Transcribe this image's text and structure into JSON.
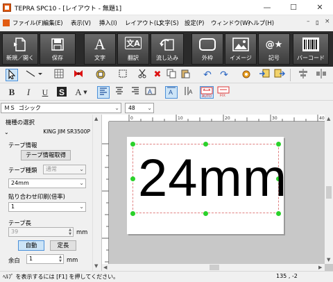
{
  "window": {
    "title": "TEPRA SPC10 - [レイアウト - 無題1]",
    "minimize_glyph": "—",
    "maximize_glyph": "☐",
    "close_glyph": "✕"
  },
  "menu": {
    "items": [
      "ファイル(F)",
      "編集(E)",
      "表示(V)",
      "挿入(I)",
      "レイアウト(L)",
      "文字(S)",
      "設定(P)",
      "ウィンドウ(W)",
      "ヘルプ(H)"
    ],
    "mdi_min": "–",
    "mdi_restore": "ﾛ",
    "mdi_close": "×"
  },
  "ribbon": {
    "buttons": [
      "新規／開く",
      "保存",
      "文字",
      "翻訳",
      "流し込み",
      "外枠",
      "イメージ",
      "記号",
      "バーコード"
    ],
    "glyphs": {
      "text": "A",
      "translate": "文A",
      "symbol": "@★"
    }
  },
  "toolbar1": {
    "icons": [
      "select-arrow-icon",
      "line-icon",
      "table-icon",
      "ribbon-icon",
      "print-icon",
      "frame-select-icon",
      "cut-icon",
      "delete-icon",
      "copy-icon",
      "paste-icon",
      "undo-icon",
      "redo-icon",
      "settings-icon",
      "import-icon",
      "export-icon",
      "align-icon",
      "distribute-icon"
    ]
  },
  "toolbar2": {
    "bold": "B",
    "italic": "I",
    "underline": "U",
    "font_a": "A"
  },
  "font_bar": {
    "font_name": "ＭＳ ゴシック",
    "font_size": "48"
  },
  "left_panel": {
    "model_label": "機種の選択",
    "model_value": "KING JIM SR3500P",
    "tape_info_label": "テープ情報",
    "get_tape_info_button": "テープ情報取得",
    "tape_type_label": "テープ種類",
    "tape_type_value": "通常",
    "tape_width_value": "24mm",
    "paste_print_label": "貼り合わせ印刷(倍率)",
    "paste_print_value": "1",
    "tape_length_label": "テープ長",
    "tape_length_value": "39",
    "tape_length_unit": "mm",
    "auto_button": "自動",
    "fixed_length_button": "定長",
    "margin_label": "余白",
    "margin_value": "1",
    "margin_unit": "mm"
  },
  "canvas": {
    "label_text": "24mm",
    "ruler_labels": [
      "0",
      "10",
      "20",
      "30",
      "40"
    ]
  },
  "status": {
    "help_text": "ﾍﾙﾌﾟ を表示するには [F1] を押してください。",
    "coordinates": "135 , -2"
  }
}
